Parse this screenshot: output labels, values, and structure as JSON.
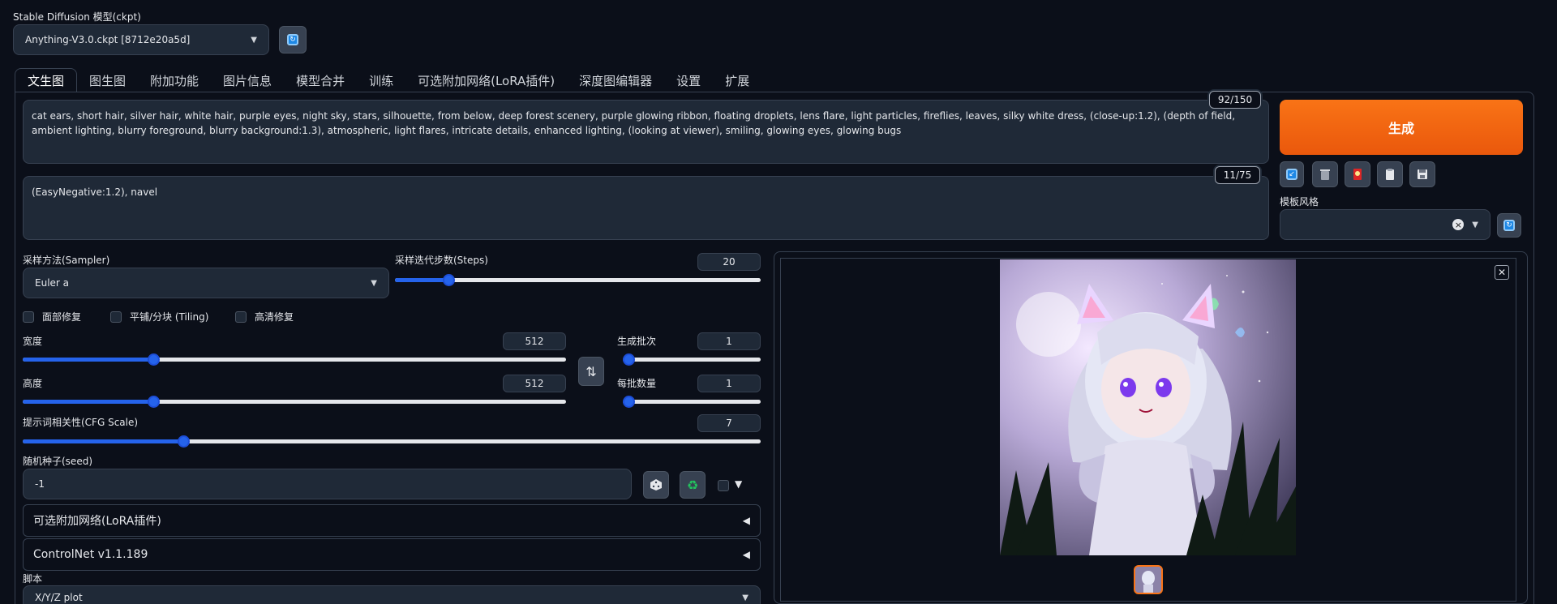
{
  "model": {
    "label": "Stable Diffusion 模型(ckpt)",
    "selected": "Anything-V3.0.ckpt [8712e20a5d]"
  },
  "tabs": [
    "文生图",
    "图生图",
    "附加功能",
    "图片信息",
    "模型合并",
    "训练",
    "可选附加网络(LoRA插件)",
    "深度图编辑器",
    "设置",
    "扩展"
  ],
  "prompt": {
    "text": "cat ears, short hair, silver hair, white hair, purple eyes, night sky, stars, silhouette, from below, deep forest scenery, purple glowing ribbon, floating droplets, lens flare, light particles, fireflies, leaves, silky white dress, (close-up:1.2), (depth of field, ambient lighting, blurry foreground, blurry background:1.3), atmospheric, light flares, intricate details, enhanced lighting, (looking at viewer), smiling, glowing eyes, glowing bugs",
    "counter": "92/150"
  },
  "negative": {
    "text": "(EasyNegative:1.2), navel",
    "counter": "11/75"
  },
  "generate_label": "生成",
  "styles": {
    "label": "模板风格",
    "clear": "×"
  },
  "sampler": {
    "label": "采样方法(Sampler)",
    "selected": "Euler a"
  },
  "steps": {
    "label": "采样迭代步数(Steps)",
    "value": "20",
    "fraction": 0.13
  },
  "checks": [
    "面部修复",
    "平铺/分块 (Tiling)",
    "高清修复"
  ],
  "width": {
    "label": "宽度",
    "value": "512",
    "fraction": 0.23
  },
  "height": {
    "label": "高度",
    "value": "512",
    "fraction": 0.23
  },
  "batch_count": {
    "label": "生成批次",
    "value": "1",
    "fraction": 0.0
  },
  "batch_size": {
    "label": "每批数量",
    "value": "1",
    "fraction": 0.0
  },
  "cfg": {
    "label": "提示词相关性(CFG Scale)",
    "value": "7",
    "fraction": 0.21
  },
  "seed": {
    "label": "随机种子(seed)",
    "value": "-1"
  },
  "accordions": {
    "lora": "可选附加网络(LoRA插件)",
    "controlnet": "ControlNet v1.1.189"
  },
  "script": {
    "label": "脚本",
    "selected": "X/Y/Z plot"
  },
  "colors": {
    "accent": "#2563eb",
    "generate": "#f97316",
    "bg": "#0b0f19"
  }
}
